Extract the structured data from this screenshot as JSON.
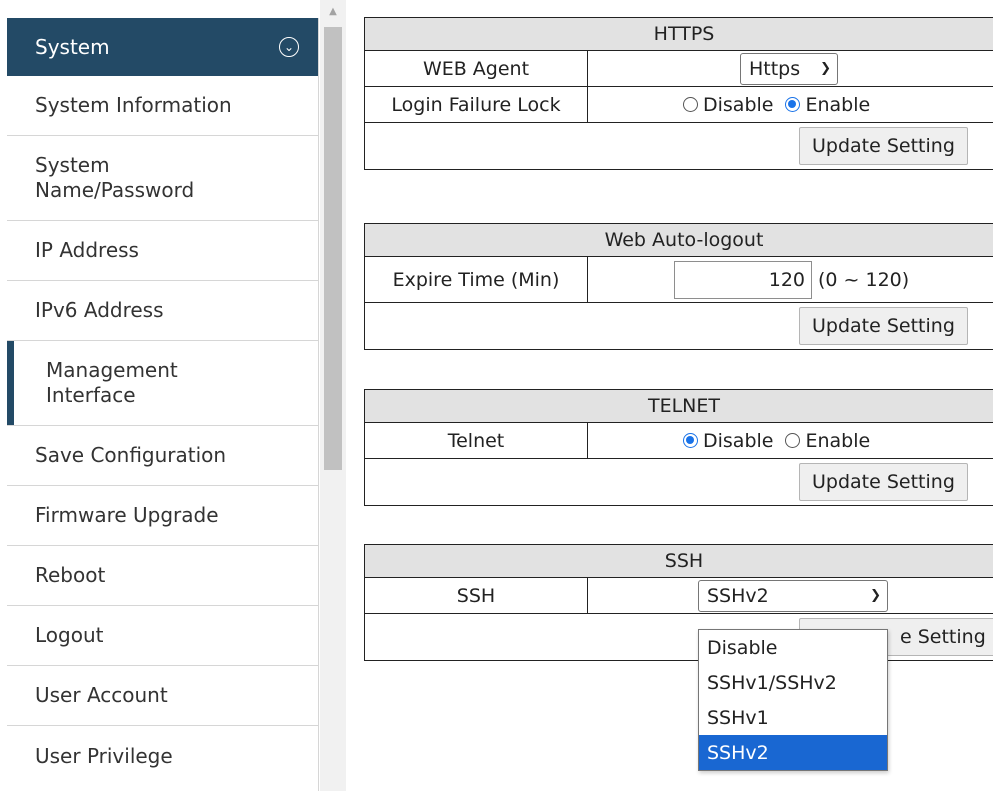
{
  "sidebar": {
    "header": "System",
    "items": [
      {
        "label": "System Information"
      },
      {
        "label": "System Name/Password"
      },
      {
        "label": "IP Address"
      },
      {
        "label": "IPv6 Address"
      },
      {
        "label": "Management Interface"
      },
      {
        "label": "Save Configuration"
      },
      {
        "label": "Firmware Upgrade"
      },
      {
        "label": "Reboot"
      },
      {
        "label": "Logout"
      },
      {
        "label": "User Account"
      },
      {
        "label": "User Privilege"
      }
    ]
  },
  "https": {
    "title": "HTTPS",
    "web_agent_label": "WEB Agent",
    "web_agent_value": "Https",
    "login_lock_label": "Login Failure Lock",
    "disable_label": "Disable",
    "enable_label": "Enable",
    "selected": "Enable",
    "update_label": "Update Setting"
  },
  "autologout": {
    "title": "Web Auto-logout",
    "expire_label": "Expire Time (Min)",
    "expire_value": "120",
    "range_hint": "(0 ~ 120)",
    "update_label": "Update Setting"
  },
  "telnet": {
    "title": "TELNET",
    "label": "Telnet",
    "disable_label": "Disable",
    "enable_label": "Enable",
    "selected": "Disable",
    "update_label": "Update Setting"
  },
  "ssh": {
    "title": "SSH",
    "label": "SSH",
    "selected": "SSHv2",
    "update_label_partial": "e Setting",
    "options": [
      "Disable",
      "SSHv1/SSHv2",
      "SSHv1",
      "SSHv2"
    ]
  },
  "colors": {
    "sidebar_header": "#234a66",
    "panel_title_bg": "#e2e2e2",
    "dropdown_selected": "#1967d2",
    "radio_selected": "#1a73e8"
  }
}
